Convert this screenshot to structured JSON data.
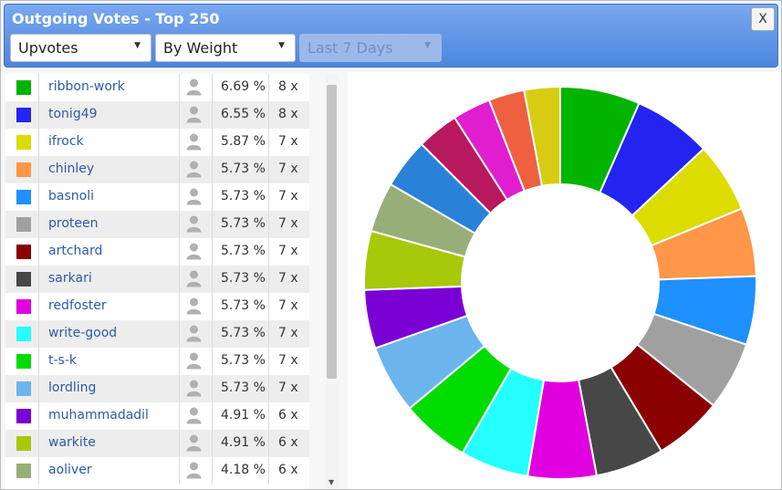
{
  "window": {
    "title": "Outgoing Votes - Top 250",
    "close_label": "X"
  },
  "filters": {
    "type": "Upvotes",
    "sort": "By Weight",
    "period": "Last 7 Days"
  },
  "list": {
    "rows": [
      {
        "name": "ribbon-work",
        "pct": "6.69 %",
        "count": "8 x",
        "color": "#00b400"
      },
      {
        "name": "tonig49",
        "pct": "6.55 %",
        "count": "8 x",
        "color": "#2424f0"
      },
      {
        "name": "ifrock",
        "pct": "5.87 %",
        "count": "7 x",
        "color": "#dcdc00"
      },
      {
        "name": "chinley",
        "pct": "5.73 %",
        "count": "7 x",
        "color": "#ff9648"
      },
      {
        "name": "basnoli",
        "pct": "5.73 %",
        "count": "7 x",
        "color": "#1e90ff"
      },
      {
        "name": "proteen",
        "pct": "5.73 %",
        "count": "7 x",
        "color": "#a0a0a0"
      },
      {
        "name": "artchard",
        "pct": "5.73 %",
        "count": "7 x",
        "color": "#8b0000"
      },
      {
        "name": "sarkari",
        "pct": "5.73 %",
        "count": "7 x",
        "color": "#474747"
      },
      {
        "name": "redfoster",
        "pct": "5.73 %",
        "count": "7 x",
        "color": "#e000e0"
      },
      {
        "name": "write-good",
        "pct": "5.73 %",
        "count": "7 x",
        "color": "#24ffff"
      },
      {
        "name": "t-s-k",
        "pct": "5.73 %",
        "count": "7 x",
        "color": "#00dc00"
      },
      {
        "name": "lordling",
        "pct": "5.73 %",
        "count": "7 x",
        "color": "#6cb4ec"
      },
      {
        "name": "muhammadadil",
        "pct": "4.91 %",
        "count": "6 x",
        "color": "#7a00d6"
      },
      {
        "name": "warkite",
        "pct": "4.91 %",
        "count": "6 x",
        "color": "#a8c80a"
      },
      {
        "name": "aoliver",
        "pct": "4.18 %",
        "count": "6 x",
        "color": "#98ae78"
      }
    ]
  },
  "chart_data": {
    "type": "pie",
    "donut": true,
    "legend": "none",
    "slices": [
      {
        "label": "ribbon-work",
        "value": 6.69,
        "color": "#00b400"
      },
      {
        "label": "tonig49",
        "value": 6.55,
        "color": "#2424f0"
      },
      {
        "label": "ifrock",
        "value": 5.87,
        "color": "#dcdc00"
      },
      {
        "label": "chinley",
        "value": 5.73,
        "color": "#ff9648"
      },
      {
        "label": "basnoli",
        "value": 5.73,
        "color": "#1e90ff"
      },
      {
        "label": "proteen",
        "value": 5.73,
        "color": "#a0a0a0"
      },
      {
        "label": "artchard",
        "value": 5.73,
        "color": "#8b0000"
      },
      {
        "label": "sarkari",
        "value": 5.73,
        "color": "#474747"
      },
      {
        "label": "redfoster",
        "value": 5.73,
        "color": "#e000e0"
      },
      {
        "label": "write-good",
        "value": 5.73,
        "color": "#24ffff"
      },
      {
        "label": "t-s-k",
        "value": 5.73,
        "color": "#00dc00"
      },
      {
        "label": "lordling",
        "value": 5.73,
        "color": "#6cb4ec"
      },
      {
        "label": "muhammadadil",
        "value": 4.91,
        "color": "#7a00d6"
      },
      {
        "label": "warkite",
        "value": 4.91,
        "color": "#a8c80a"
      },
      {
        "label": "aoliver",
        "value": 4.18,
        "color": "#98ae78"
      },
      {
        "value": 4.18,
        "color": "#2a82d8"
      },
      {
        "value": 3.5,
        "color": "#b8195e"
      },
      {
        "value": 3.2,
        "color": "#e01ed0"
      },
      {
        "value": 3.0,
        "color": "#ee6040"
      },
      {
        "value": 3.0,
        "color": "#d8cc12"
      }
    ]
  }
}
